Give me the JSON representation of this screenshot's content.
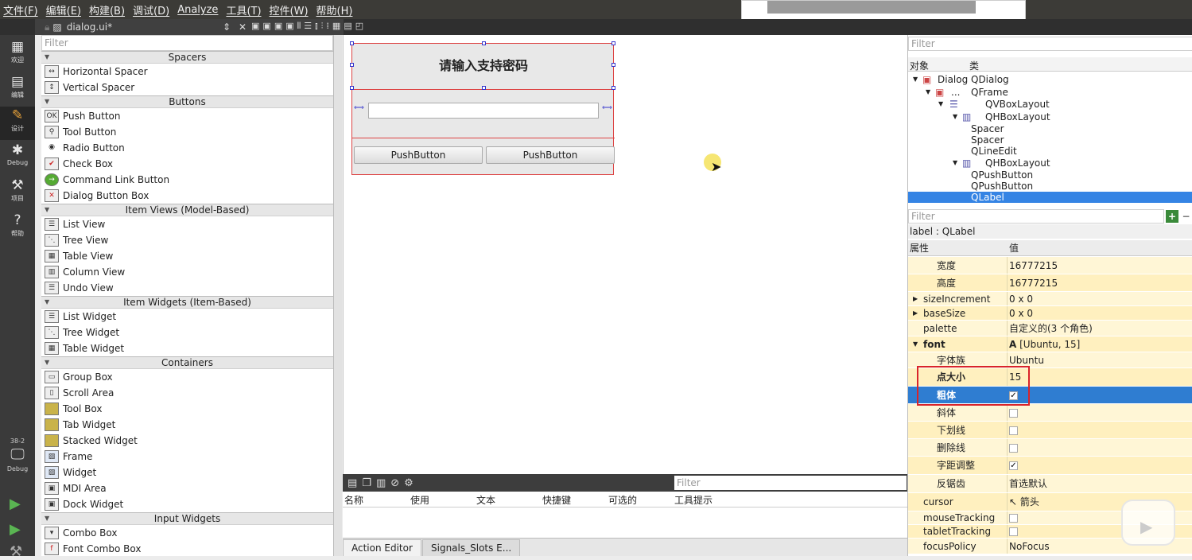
{
  "menubar": {
    "items": [
      "文件(F)",
      "编辑(E)",
      "构建(B)",
      "调试(D)",
      "Analyze",
      "工具(T)",
      "控件(W)",
      "帮助(H)"
    ]
  },
  "modes": [
    {
      "label": "欢迎",
      "icon": "grid-icon"
    },
    {
      "label": "编辑",
      "icon": "document-icon"
    },
    {
      "label": "设计",
      "icon": "pencil-icon"
    },
    {
      "label": "Debug",
      "icon": "bug-icon"
    },
    {
      "label": "项目",
      "icon": "wrench-icon"
    },
    {
      "label": "帮助",
      "icon": "help-icon"
    }
  ],
  "kit": {
    "name": "38-2",
    "mode": "Debug"
  },
  "file_tab": {
    "name": "dialog.ui*"
  },
  "widgetbox": {
    "filter_placeholder": "Filter",
    "categories": [
      {
        "name": "Spacers",
        "items": [
          "Horizontal Spacer",
          "Vertical Spacer"
        ]
      },
      {
        "name": "Buttons",
        "items": [
          "Push Button",
          "Tool Button",
          "Radio Button",
          "Check Box",
          "Command Link Button",
          "Dialog Button Box"
        ]
      },
      {
        "name": "Item Views (Model-Based)",
        "items": [
          "List View",
          "Tree View",
          "Table View",
          "Column View",
          "Undo View"
        ]
      },
      {
        "name": "Item Widgets (Item-Based)",
        "items": [
          "List Widget",
          "Tree Widget",
          "Table Widget"
        ]
      },
      {
        "name": "Containers",
        "items": [
          "Group Box",
          "Scroll Area",
          "Tool Box",
          "Tab Widget",
          "Stacked Widget",
          "Frame",
          "Widget",
          "MDI Area",
          "Dock Widget"
        ]
      },
      {
        "name": "Input Widgets",
        "items": [
          "Combo Box",
          "Font Combo Box"
        ]
      }
    ]
  },
  "form": {
    "title": "请输入支持密码",
    "button1": "PushButton",
    "button2": "PushButton"
  },
  "action_editor": {
    "filter_placeholder": "Filter",
    "columns": [
      "名称",
      "使用",
      "文本",
      "快捷键",
      "可选的",
      "工具提示"
    ]
  },
  "bottom_tabs": [
    "Action Editor",
    "Signals_Slots E..."
  ],
  "object_inspector": {
    "filter_placeholder": "Filter",
    "col_object": "对象",
    "col_class": "类",
    "rows": [
      {
        "name": "Dialog",
        "cls": "QDialog"
      },
      {
        "name": "...",
        "cls": "QFrame"
      },
      {
        "name": "",
        "cls": "QVBoxLayout"
      },
      {
        "name": "",
        "cls": "QHBoxLayout"
      },
      {
        "name": "",
        "cls": "Spacer"
      },
      {
        "name": "",
        "cls": "Spacer"
      },
      {
        "name": "",
        "cls": "QLineEdit"
      },
      {
        "name": "",
        "cls": "QHBoxLayout"
      },
      {
        "name": "",
        "cls": "QPushButton"
      },
      {
        "name": "",
        "cls": "QPushButton"
      },
      {
        "name": "",
        "cls": "QLabel"
      }
    ]
  },
  "property_editor": {
    "filter_placeholder": "Filter",
    "class_label": "label : QLabel",
    "col_property": "属性",
    "col_value": "值",
    "rows": [
      {
        "key": "宽度",
        "value": "16777215"
      },
      {
        "key": "高度",
        "value": "16777215"
      },
      {
        "key": "sizeIncrement",
        "value": "0 x 0"
      },
      {
        "key": "baseSize",
        "value": "0 x 0"
      },
      {
        "key": "palette",
        "value": "自定义的(3 个角色)"
      },
      {
        "key": "font",
        "value": "[Ubuntu, 15]"
      },
      {
        "key": "字体族",
        "value": "Ubuntu"
      },
      {
        "key": "点大小",
        "value": "15"
      },
      {
        "key": "粗体",
        "value": "✓"
      },
      {
        "key": "斜体",
        "value": ""
      },
      {
        "key": "下划线",
        "value": ""
      },
      {
        "key": "删除线",
        "value": ""
      },
      {
        "key": "字距调整",
        "value": "✓"
      },
      {
        "key": "反锯齿",
        "value": "首选默认"
      },
      {
        "key": "cursor",
        "value": "箭头"
      },
      {
        "key": "mouseTracking",
        "value": ""
      },
      {
        "key": "tabletTracking",
        "value": ""
      },
      {
        "key": "focusPolicy",
        "value": "NoFocus"
      }
    ]
  }
}
